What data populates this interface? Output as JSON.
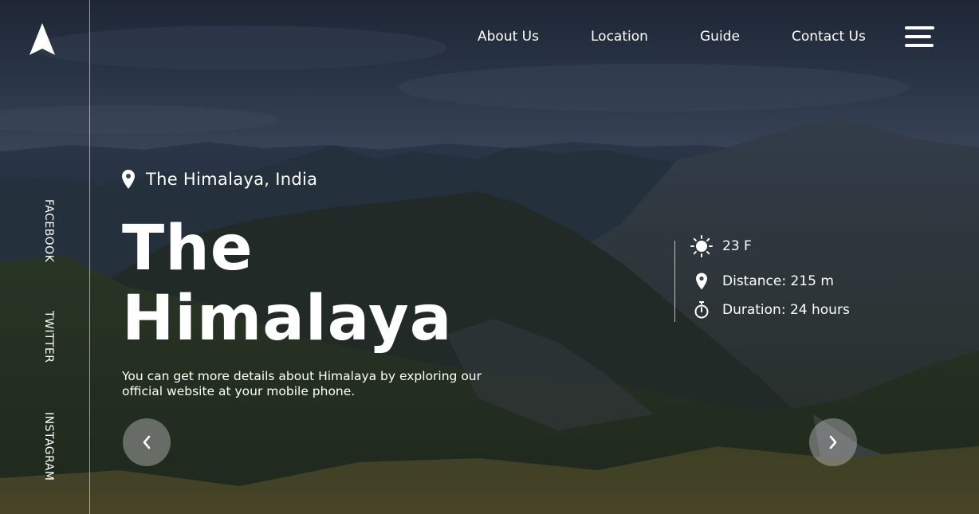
{
  "brand": {
    "logo_icon": "navigation-arrow-icon"
  },
  "social": [
    {
      "label": "FACEBOOK"
    },
    {
      "label": "TWITTER"
    },
    {
      "label": "INSTAGRAM"
    }
  ],
  "nav": {
    "items": [
      {
        "label": "About Us"
      },
      {
        "label": "Location"
      },
      {
        "label": "Guide"
      },
      {
        "label": "Contact Us"
      }
    ],
    "menu_icon": "hamburger-menu-icon"
  },
  "hero": {
    "location": "The Himalaya, India",
    "title_line1": "The",
    "title_line2": "Himalaya",
    "description": "You can get more details about Himalaya by exploring our official website at your mobile phone."
  },
  "stats": {
    "temperature": "23 F",
    "distance": "Distance: 215 m",
    "duration": "Duration: 24 hours"
  },
  "carousel": {
    "prev_icon": "chevron-left-icon",
    "next_icon": "chevron-right-icon"
  },
  "colors": {
    "text": "#ffffff",
    "rail_line": "#ffffff",
    "arrow_button_bg": "#c8c8c8"
  }
}
